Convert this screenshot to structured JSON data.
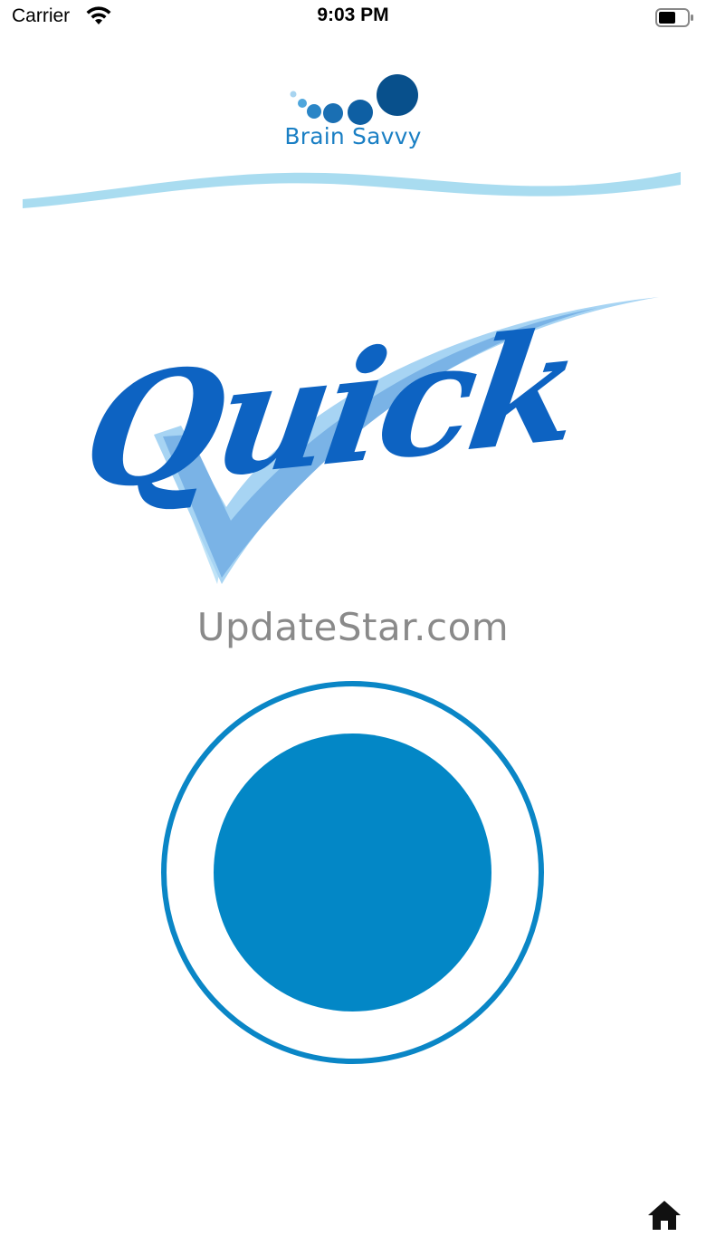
{
  "status_bar": {
    "carrier": "Carrier",
    "time": "9:03 PM",
    "wifi_icon": "wifi-icon",
    "battery_icon": "battery-icon"
  },
  "logo": {
    "text": "Brain Savvy",
    "color": "#1a7fc4"
  },
  "hero": {
    "title": "Quick",
    "title_color": "#0d63c2",
    "check_color": "#7ab3e6"
  },
  "site": {
    "text": "UpdateStar.com",
    "color": "#8a8a8a"
  },
  "record_button": {
    "color": "#0387c6"
  },
  "nav": {
    "home_icon": "home-icon"
  }
}
